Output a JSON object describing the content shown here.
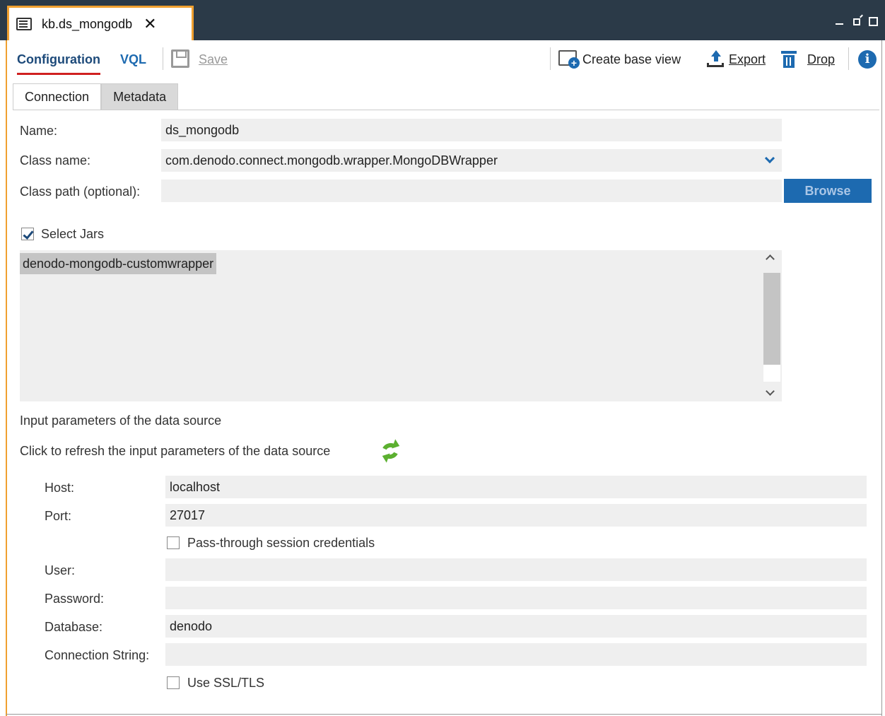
{
  "window": {
    "tab_title": "kb.ds_mongodb",
    "close_glyph": "✕"
  },
  "toolbar": {
    "configuration_label": "Configuration",
    "vql_label": "VQL",
    "save_label": "Save",
    "create_base_view_label": "Create base view",
    "export_label": "Export",
    "drop_label": "Drop",
    "info_glyph": "i"
  },
  "tabs": [
    {
      "label": "Connection",
      "active": true
    },
    {
      "label": "Metadata",
      "active": false
    }
  ],
  "form": {
    "name_label": "Name:",
    "name_value": "ds_mongodb",
    "class_name_label": "Class name:",
    "class_name_value": "com.denodo.connect.mongodb.wrapper.MongoDBWrapper",
    "class_path_label": "Class path (optional):",
    "class_path_value": "",
    "browse_label": "Browse",
    "select_jars_label": "Select Jars",
    "select_jars_checked": true,
    "jars": [
      "denodo-mongodb-customwrapper"
    ],
    "input_params_heading": "Input parameters of the data source",
    "refresh_text": "Click to refresh the input parameters of the data source"
  },
  "params": {
    "host_label": "Host:",
    "host_value": "localhost",
    "port_label": "Port:",
    "port_value": "27017",
    "passthrough_label": "Pass-through session credentials",
    "passthrough_checked": false,
    "user_label": "User:",
    "user_value": "",
    "password_label": "Password:",
    "password_value": "",
    "database_label": "Database:",
    "database_value": "denodo",
    "connection_string_label": "Connection String:",
    "connection_string_value": "",
    "ssl_label": "Use SSL/TLS",
    "ssl_checked": false
  },
  "colors": {
    "titlebar": "#2b3a48",
    "accent_orange": "#f0a030",
    "accent_blue": "#1d6ab0",
    "active_underline": "#d02020",
    "refresh_green": "#5cb030"
  },
  "icons": {
    "tab": "document-window-icon",
    "save": "save-disk-icon",
    "create": "create-view-icon",
    "export": "export-upload-icon",
    "drop": "trash-icon",
    "info": "info-icon",
    "refresh": "refresh-icon"
  }
}
